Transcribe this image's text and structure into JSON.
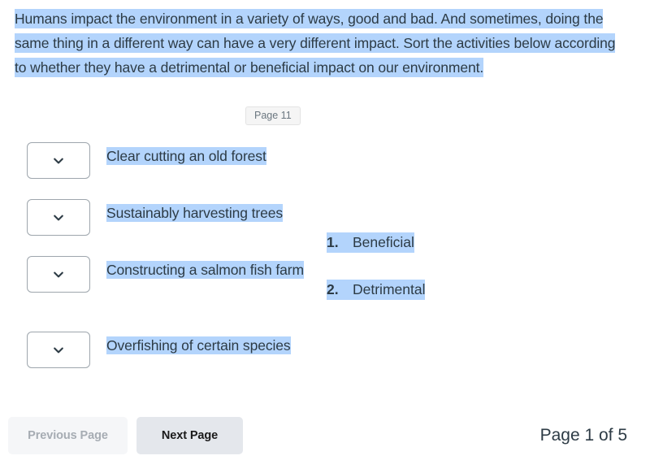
{
  "prompt": {
    "text": "Humans impact the environment in a variety of ways, good and bad. And sometimes, doing the same thing in a different way can have a very different impact. Sort the activities below according to whether they have a detrimental or beneficial impact on our environment."
  },
  "page_badge": {
    "label": "Page 11"
  },
  "match_rows": [
    {
      "label": "Clear cutting an old forest",
      "selected_value": "",
      "dropdown_icon": "chevron-down-icon"
    },
    {
      "label": "Sustainably harvesting trees",
      "selected_value": "",
      "dropdown_icon": "chevron-down-icon"
    },
    {
      "label": "Constructing a salmon fish farm",
      "selected_value": "",
      "dropdown_icon": "chevron-down-icon"
    },
    {
      "label": "Overfishing of certain species",
      "selected_value": "",
      "dropdown_icon": "chevron-down-icon"
    }
  ],
  "answers": [
    {
      "number": "1.",
      "text": "Beneficial"
    },
    {
      "number": "2.",
      "text": "Detrimental"
    }
  ],
  "footer": {
    "previous_label": "Previous Page",
    "next_label": "Next Page",
    "page_counter": "Page 1 of 5"
  },
  "colors": {
    "selection_highlight": "#b3d4fc",
    "text": "#2d3b45",
    "badge_bg": "#f5f5f5",
    "prev_button_bg": "#f5f6f8",
    "prev_button_text": "#a6acb3",
    "next_button_bg": "#e4e7ec",
    "next_button_text": "#1a1a1a",
    "dropdown_border": "#9ea6ad"
  }
}
